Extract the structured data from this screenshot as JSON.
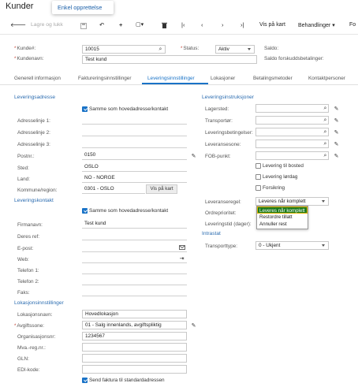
{
  "app": {
    "title": "Kunder",
    "tooltip": "Enkel opprettelse"
  },
  "toolbar": {
    "save_close": "Lagre og lukk",
    "show_map": "Vis på kart",
    "actions": "Behandlinger",
    "more": "Fo"
  },
  "header": {
    "customer_label": "Kunde#:",
    "customer_value": "10015",
    "status_label": "Status:",
    "status_value": "Aktiv",
    "balance_label": "Saldo:",
    "name_label": "Kundenavn:",
    "name_value": "Test kund",
    "prepay_label": "Saldo forskuddsbetalinger:"
  },
  "tabs": [
    "Generell informasjon",
    "Faktureringsinnstillinger",
    "Leveringsinnstillinger",
    "Lokasjoner",
    "Betalingsmetoder",
    "Kontaktpersoner"
  ],
  "delivery_address": {
    "title": "Leveringsadresse",
    "same_as_main": "Samme som hovedadresse/kontakt",
    "line1_label": "Adresselinje 1:",
    "line2_label": "Adresselinje 2:",
    "line3_label": "Adresselinje 3:",
    "postal_label": "Postnr.:",
    "postal_value": "0150",
    "city_label": "Sted:",
    "city_value": "OSLO",
    "country_label": "Land:",
    "country_value": "NO - NORGE",
    "municipality_label": "Kommune/region:",
    "municipality_value": "0301 - OSLO",
    "map_button": "Vis på kart"
  },
  "delivery_contact": {
    "title": "Leveringskontakt",
    "same_as_main": "Samme som hovedadresse/kontakt",
    "company_label": "Firmanavn:",
    "company_value": "Test kund",
    "attention_label": "Deres ref:",
    "email_label": "E-post:",
    "web_label": "Web:",
    "phone1_label": "Telefon 1:",
    "phone2_label": "Telefon 2:",
    "fax_label": "Faks:"
  },
  "location_settings": {
    "title": "Lokasjonsinnstillinger",
    "name_label": "Lokasjonsnavn:",
    "name_value": "Hovedlokasjon",
    "tax_zone_label": "Avgiftssone:",
    "tax_zone_value": "01 - Salg innenlands, avgiftspliktig",
    "org_label": "Organisasjonsnr:",
    "org_value": "1234567",
    "vat_label": "Mva.-reg.nr.:",
    "gln_label": "GLN:",
    "edi_label": "EDI-kode:",
    "send_invoice": "Send faktura til standardadressen"
  },
  "delivery_instructions": {
    "title": "Leveringsinstruksjoner",
    "warehouse_label": "Lagersted:",
    "carrier_label": "Transportør:",
    "terms_label": "Leveringsbetingelser:",
    "zone_label": "Leveransesone:",
    "fob_label": "FOB-punkt:",
    "residential": "Levering til bosted",
    "saturday": "Levering lørdag",
    "insurance": "Forsikring",
    "rule_label": "Leveranseregel:",
    "rule_value": "Leveres når komplett",
    "rule_options": [
      "Leveres når komplett",
      "Restordre tillatt",
      "Annuller rest"
    ],
    "order_priority_label": "Ordreprioritet:",
    "lead_time_label": "Leveringstid (dager):"
  },
  "intrastat": {
    "title": "Intrastat",
    "transport_label": "Transporttype:",
    "transport_value": "0 - Ukjent"
  }
}
